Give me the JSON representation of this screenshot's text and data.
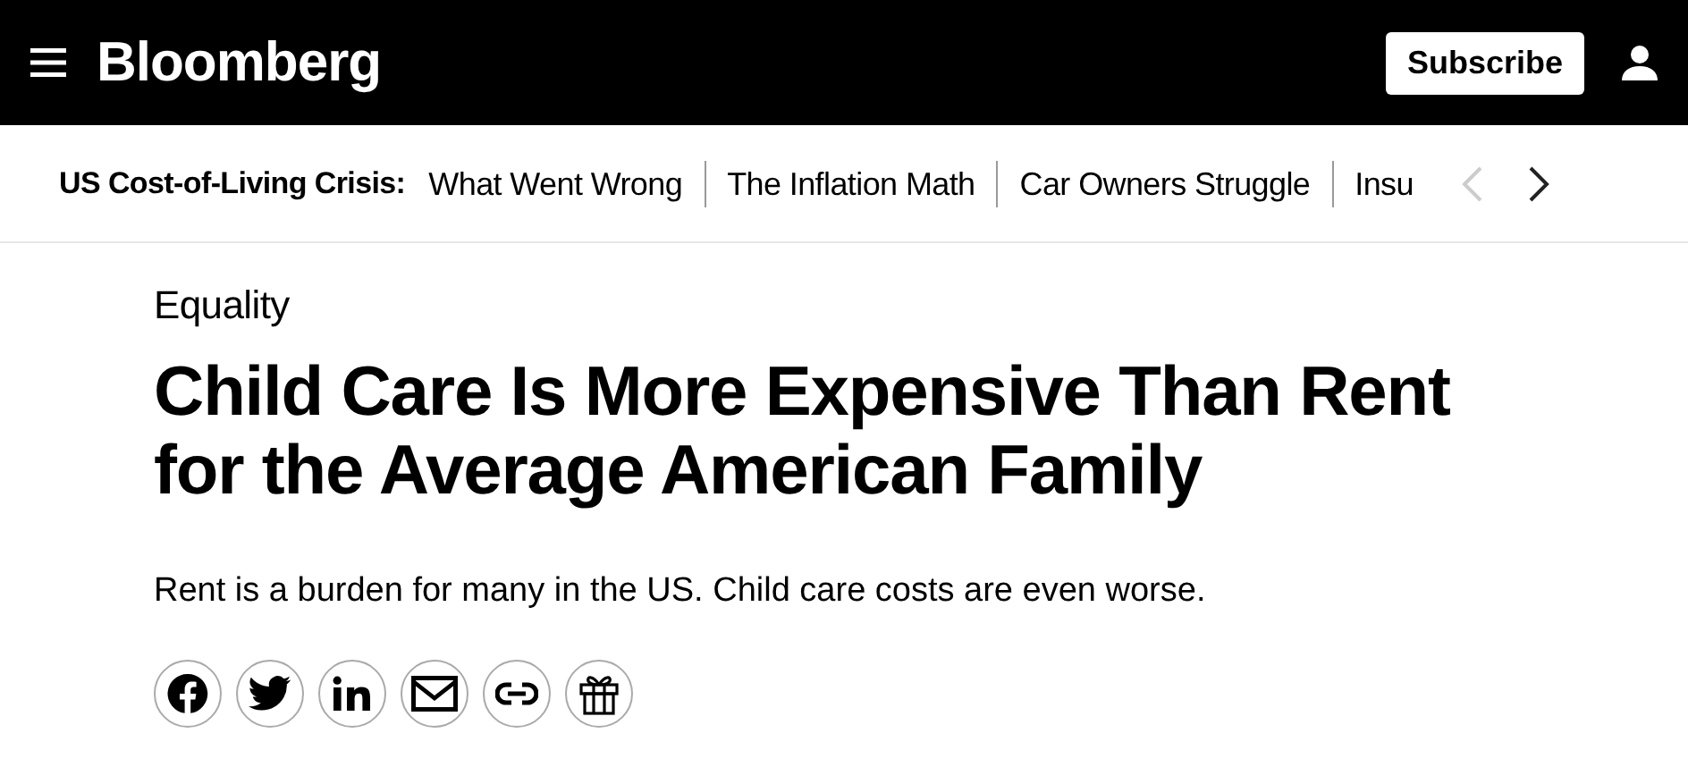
{
  "header": {
    "logo": "Bloomberg",
    "subscribe": "Subscribe"
  },
  "topic_bar": {
    "label": "US Cost-of-Living Crisis:",
    "links": [
      "What Went Wrong",
      "The Inflation Math",
      "Car Owners Struggle",
      "Insu"
    ],
    "prev_disabled": true,
    "next_disabled": false
  },
  "article": {
    "category": "Equality",
    "headline": "Child Care Is More Expensive Than Rent for the Average American Family",
    "dek": "Rent is a burden for many in the US. Child care costs are even worse.",
    "share": [
      {
        "kind": "facebook"
      },
      {
        "kind": "twitter"
      },
      {
        "kind": "linkedin"
      },
      {
        "kind": "email"
      },
      {
        "kind": "link"
      },
      {
        "kind": "gift"
      }
    ]
  }
}
